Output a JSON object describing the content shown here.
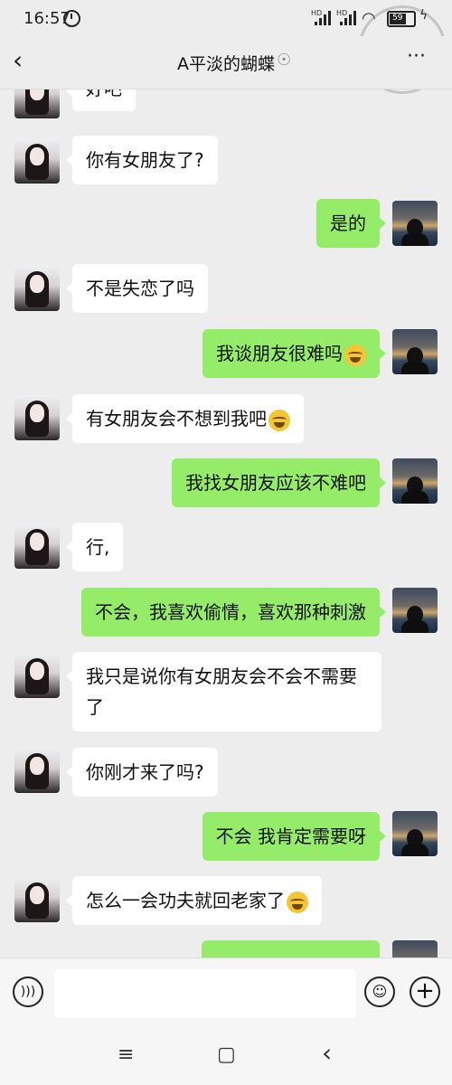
{
  "status_bar": {
    "time": "16:57",
    "signal1": "HD",
    "signal2": "HD",
    "battery": "59"
  },
  "header": {
    "back_icon": "chevron-left",
    "title": "A平淡的蝴蝶",
    "ear_icon": "ear-icon",
    "more": "···"
  },
  "messages": [
    {
      "side": "left",
      "text": "好吧"
    },
    {
      "side": "left",
      "text": "你有女朋友了?"
    },
    {
      "side": "right",
      "text": "是的"
    },
    {
      "side": "left",
      "text": "不是失恋了吗"
    },
    {
      "side": "right",
      "text": "我谈朋友很难吗",
      "emoji": "crying-laughing"
    },
    {
      "side": "left",
      "text": "有女朋友会不想到我吧",
      "emoji": "crying-laughing"
    },
    {
      "side": "right",
      "text": "我找女朋友应该不难吧"
    },
    {
      "side": "left",
      "text": "行,"
    },
    {
      "side": "right",
      "text": "不会，我喜欢偷情，喜欢那种刺激"
    },
    {
      "side": "left",
      "text": "我只是说你有女朋友会不会不需要了"
    },
    {
      "side": "left",
      "text": "你刚才来了吗?"
    },
    {
      "side": "right",
      "text": "不会  我肯定需要呀"
    },
    {
      "side": "left",
      "text": "怎么一会功夫就回老家了",
      "emoji": "crying-laughing"
    }
  ],
  "input": {
    "placeholder": ""
  },
  "nav": {
    "menu": "≡",
    "home": "▢",
    "back": "‹"
  }
}
